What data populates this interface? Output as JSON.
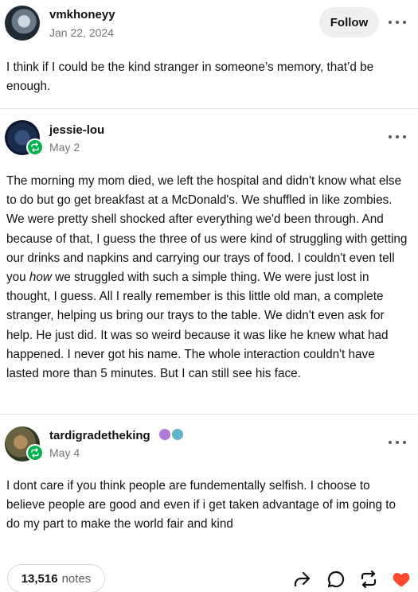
{
  "posts": [
    {
      "username": "vmkhoneyy",
      "date": "Jan 22, 2024",
      "follow_label": "Follow",
      "body": "I think if I could be the kind stranger in someone’s memory, that’d be enough."
    },
    {
      "username": "jessie-lou",
      "date": "May 2",
      "body_before_em": "The morning my mom died, we left the hospital and didn't know what else to do but go get breakfast at a McDonald's. We shuffled in like zombies. We were pretty shell shocked after everything we'd been through. And because of that, I guess the three of us were kind of struggling with getting our drinks and napkins and carrying our trays of food. I couldn't even tell you ",
      "body_em": "how",
      "body_after_em": " we struggled with such a simple thing. We were just lost in thought, I guess. All I really remember is this little old man, a complete stranger, helping us bring our trays to the table. We didn't even ask for help. He just did. It was so weird because it was like he knew what had happened. I never got his name. The whole interaction couldn't have lasted more than 5 minutes. But I can still see his face."
    },
    {
      "username": "tardigradetheking",
      "date": "May 4",
      "body": "I dont care if you think people are fundementally selfish. I choose to believe people are good and even if i get taken advantage of im going to do my part to make the world fair and kind"
    }
  ],
  "footer": {
    "notes_count": "13,516",
    "notes_label": "notes"
  },
  "icons": {
    "more": "more-options-icon",
    "share": "share-icon",
    "reply": "reply-icon",
    "reblog": "reblog-icon",
    "like": "heart-icon",
    "badge_reblog": "reblog-badge-icon"
  },
  "colors": {
    "like": "#ff4930",
    "reblog_badge": "#00b24d",
    "secondary_text": "#757575",
    "follow_bg": "#efefef"
  }
}
